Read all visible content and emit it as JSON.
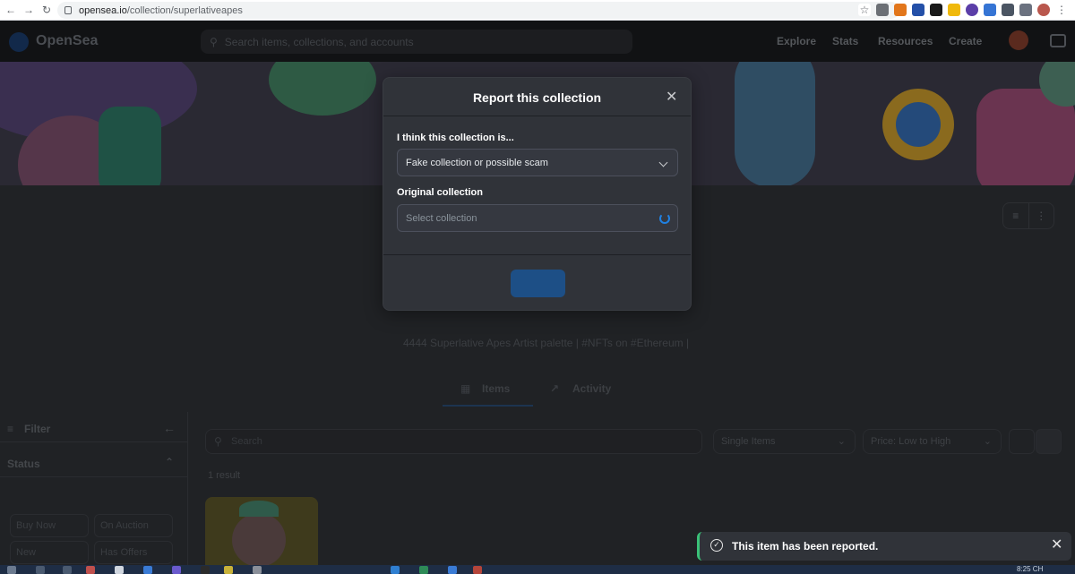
{
  "browser": {
    "url_host": "opensea.io",
    "url_path": "/collection/superlativeapes"
  },
  "header": {
    "logo_text": "OpenSea",
    "search_placeholder": "Search items, collections, and accounts",
    "nav": [
      "Explore",
      "Stats",
      "Resources",
      "Create"
    ]
  },
  "collection": {
    "description": "4444 Superlative Apes Artist palette | #NFTs on #Ethereum |"
  },
  "tabs": {
    "items_label": "Items",
    "activity_label": "Activity"
  },
  "sidebar": {
    "filter_label": "Filter",
    "status_label": "Status",
    "chips": [
      "Buy Now",
      "On Auction",
      "New",
      "Has Offers"
    ]
  },
  "toolbar": {
    "search_placeholder": "Search",
    "items_select": "Single Items",
    "sort_select": "Price: Low to High"
  },
  "results": {
    "count_text": "1 result"
  },
  "modal": {
    "title": "Report this collection",
    "reason_label": "I think this collection is...",
    "reason_value": "Fake collection or possible scam",
    "original_label": "Original collection",
    "original_placeholder": "Select collection"
  },
  "toast": {
    "message": "This item has been reported.",
    "accent_color": "#3ac178"
  },
  "taskbar": {
    "clock": "8:25 CH"
  }
}
